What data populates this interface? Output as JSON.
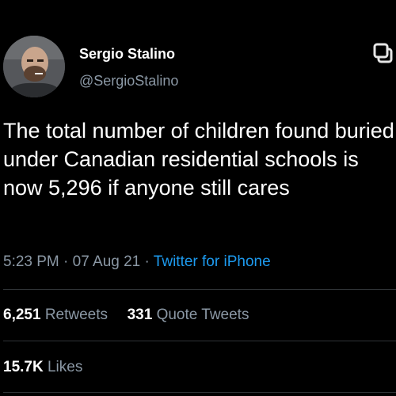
{
  "author": {
    "display_name": "Sergio Stalino",
    "handle": "@SergioStalino",
    "avatar_icon": "profile-photo"
  },
  "tweet": {
    "text": "The total number of children found buried under Canadian residential schools is now 5,296 if anyone still cares",
    "time": "5:23 PM",
    "separator": "·",
    "date": "07 Aug 21",
    "source": "Twitter for iPhone"
  },
  "stats": {
    "retweets_count": "6,251",
    "retweets_label": "Retweets",
    "quote_count": "331",
    "quote_label": "Quote Tweets",
    "likes_count": "15.7K",
    "likes_label": "Likes"
  },
  "colors": {
    "background": "#000000",
    "primary_text": "#ffffff",
    "secondary_text": "#8b98a5",
    "link": "#1d9bf0",
    "divider": "#2f3336"
  },
  "icons": {
    "top_right": "copy-icon"
  }
}
